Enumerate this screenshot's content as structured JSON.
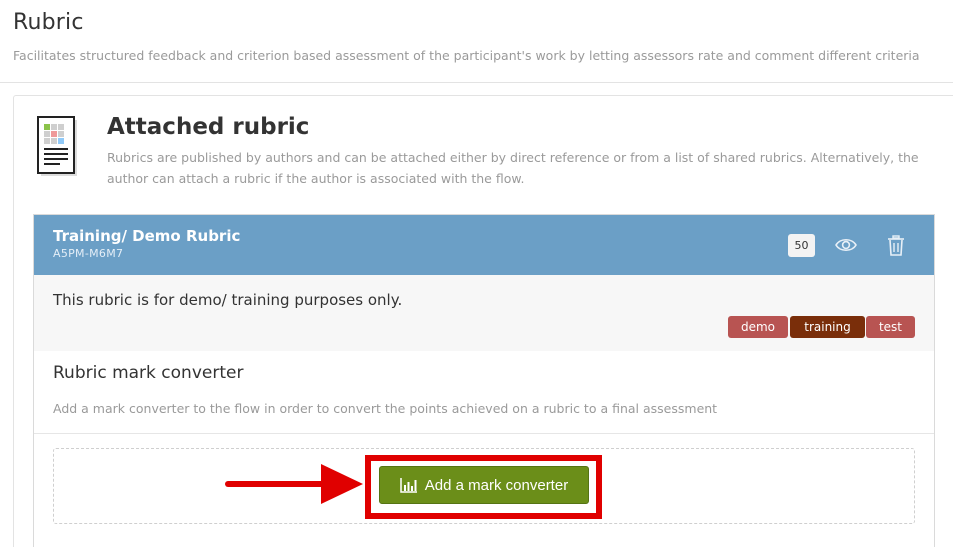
{
  "page": {
    "title": "Rubric",
    "subtitle": "Facilitates structured feedback and criterion based assessment of the participant's work by letting assessors rate and comment different criteria"
  },
  "attached": {
    "title": "Attached rubric",
    "description": "Rubrics are published by authors and can be attached either by direct reference or from a list of shared rubrics. Alternatively, the author can attach a rubric if the author is associated with the flow.",
    "icon": "document-list-icon"
  },
  "rubric": {
    "name": "Training/ Demo Rubric",
    "code": "A5PM-M6M7",
    "points": "50",
    "description": "This rubric is for demo/ training purposes only.",
    "header_color": "#6b9fc6",
    "tags": [
      {
        "label": "demo",
        "color": "#b85452"
      },
      {
        "label": "training",
        "color": "#7a2e0a"
      },
      {
        "label": "test",
        "color": "#b85452"
      }
    ]
  },
  "converter": {
    "title": "Rubric mark converter",
    "description": "Add a mark converter to the flow in order to convert the points achieved on a rubric to a final assessment",
    "button_label": "Add a mark converter",
    "button_color": "#6b8e19",
    "highlight_color": "#e00000"
  }
}
